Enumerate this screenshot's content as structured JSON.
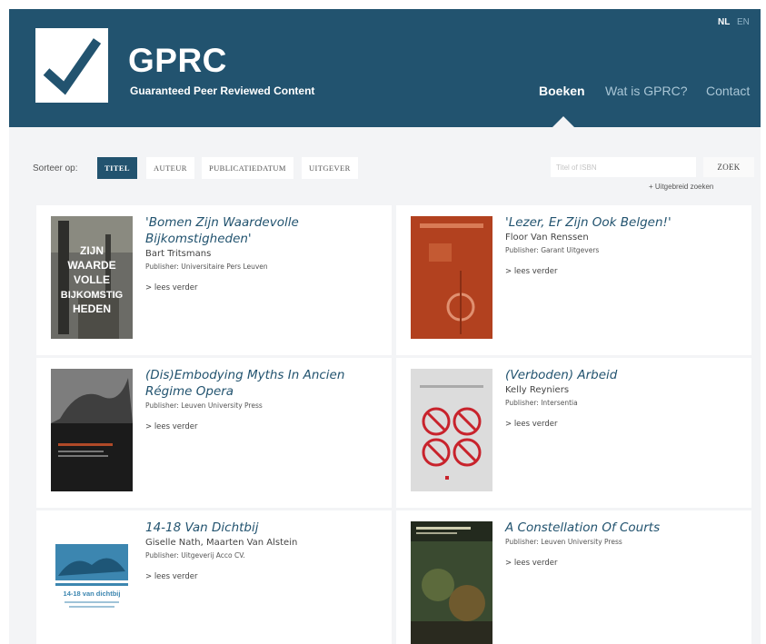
{
  "header": {
    "brand_title": "GPRC",
    "brand_subtitle": "Guaranteed Peer Reviewed Content",
    "lang": {
      "nl": "NL",
      "en": "EN"
    },
    "nav": {
      "boeken": "Boeken",
      "wat": "Wat is GPRC?",
      "contact": "Contact"
    }
  },
  "sort": {
    "label": "Sorteer op:",
    "options": [
      "TITEL",
      "AUTEUR",
      "PUBLICATIEDATUM",
      "UITGEVER"
    ],
    "active": "TITEL"
  },
  "search": {
    "placeholder": "Titel of ISBN",
    "button": "ZOEK",
    "advanced": "+ Uitgebreid zoeken"
  },
  "books": [
    {
      "title": "'Bomen Zijn Waardevolle Bijkomstigheden'",
      "author": "Bart Tritsmans",
      "publisher": "Publisher: Universitaire Pers Leuven",
      "more": "> lees verder",
      "cover_text": "ZIJN WAARDE VOLLE BIJKOMSTIG HEDEN"
    },
    {
      "title": "'Lezer, Er Zijn Ook Belgen!'",
      "author": "Floor Van Renssen",
      "publisher": "Publisher: Garant Uitgevers",
      "more": "> lees verder",
      "cover_text": ""
    },
    {
      "title": "(Dis)Embodying Myths In Ancien Régime Opera",
      "author": "",
      "publisher": "Publisher: Leuven University Press",
      "more": "> lees verder",
      "cover_text": ""
    },
    {
      "title": "(Verboden) Arbeid",
      "author": "Kelly Reyniers",
      "publisher": "Publisher: Intersentia",
      "more": "> lees verder",
      "cover_text": ""
    },
    {
      "title": "14-18 Van Dichtbij",
      "author": "Giselle Nath, Maarten Van Alstein",
      "publisher": "Publisher: Uitgeverij Acco CV.",
      "more": "> lees verder",
      "cover_text": "14-18 van dichtbij"
    },
    {
      "title": "A Constellation Of Courts",
      "author": "",
      "publisher": "Publisher: Leuven University Press",
      "more": "> lees verder",
      "cover_text": ""
    }
  ],
  "colors": {
    "header_bg": "#22536f",
    "content_bg": "#f3f4f6",
    "title_color": "#22536f"
  }
}
